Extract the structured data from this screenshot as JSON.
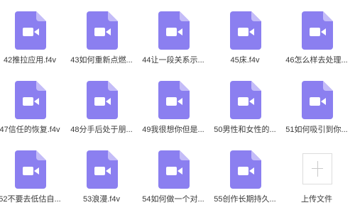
{
  "files": [
    {
      "label": "42推拉应用.f4v"
    },
    {
      "label": "43如何重新点燃..."
    },
    {
      "label": "44让一段关系示..."
    },
    {
      "label": "45床.f4v"
    },
    {
      "label": "46怎么样去处理..."
    },
    {
      "label": "47信任的恢复.f4v"
    },
    {
      "label": "48分手后处于朋..."
    },
    {
      "label": "49我很想你但是..."
    },
    {
      "label": "50男性和女性的..."
    },
    {
      "label": "51如何吸引到你..."
    },
    {
      "label": "52不要去低估自..."
    },
    {
      "label": "53浪漫.f4v"
    },
    {
      "label": "54如何做一个对..."
    },
    {
      "label": "55创作长期持久..."
    }
  ],
  "upload": {
    "label": "上传文件"
  },
  "icon": "video-file-icon",
  "colors": {
    "icon_body": "#8b7ff0",
    "icon_fold": "#c4bcf8",
    "icon_glyph": "#ffffff",
    "text": "#3a3a3a"
  }
}
